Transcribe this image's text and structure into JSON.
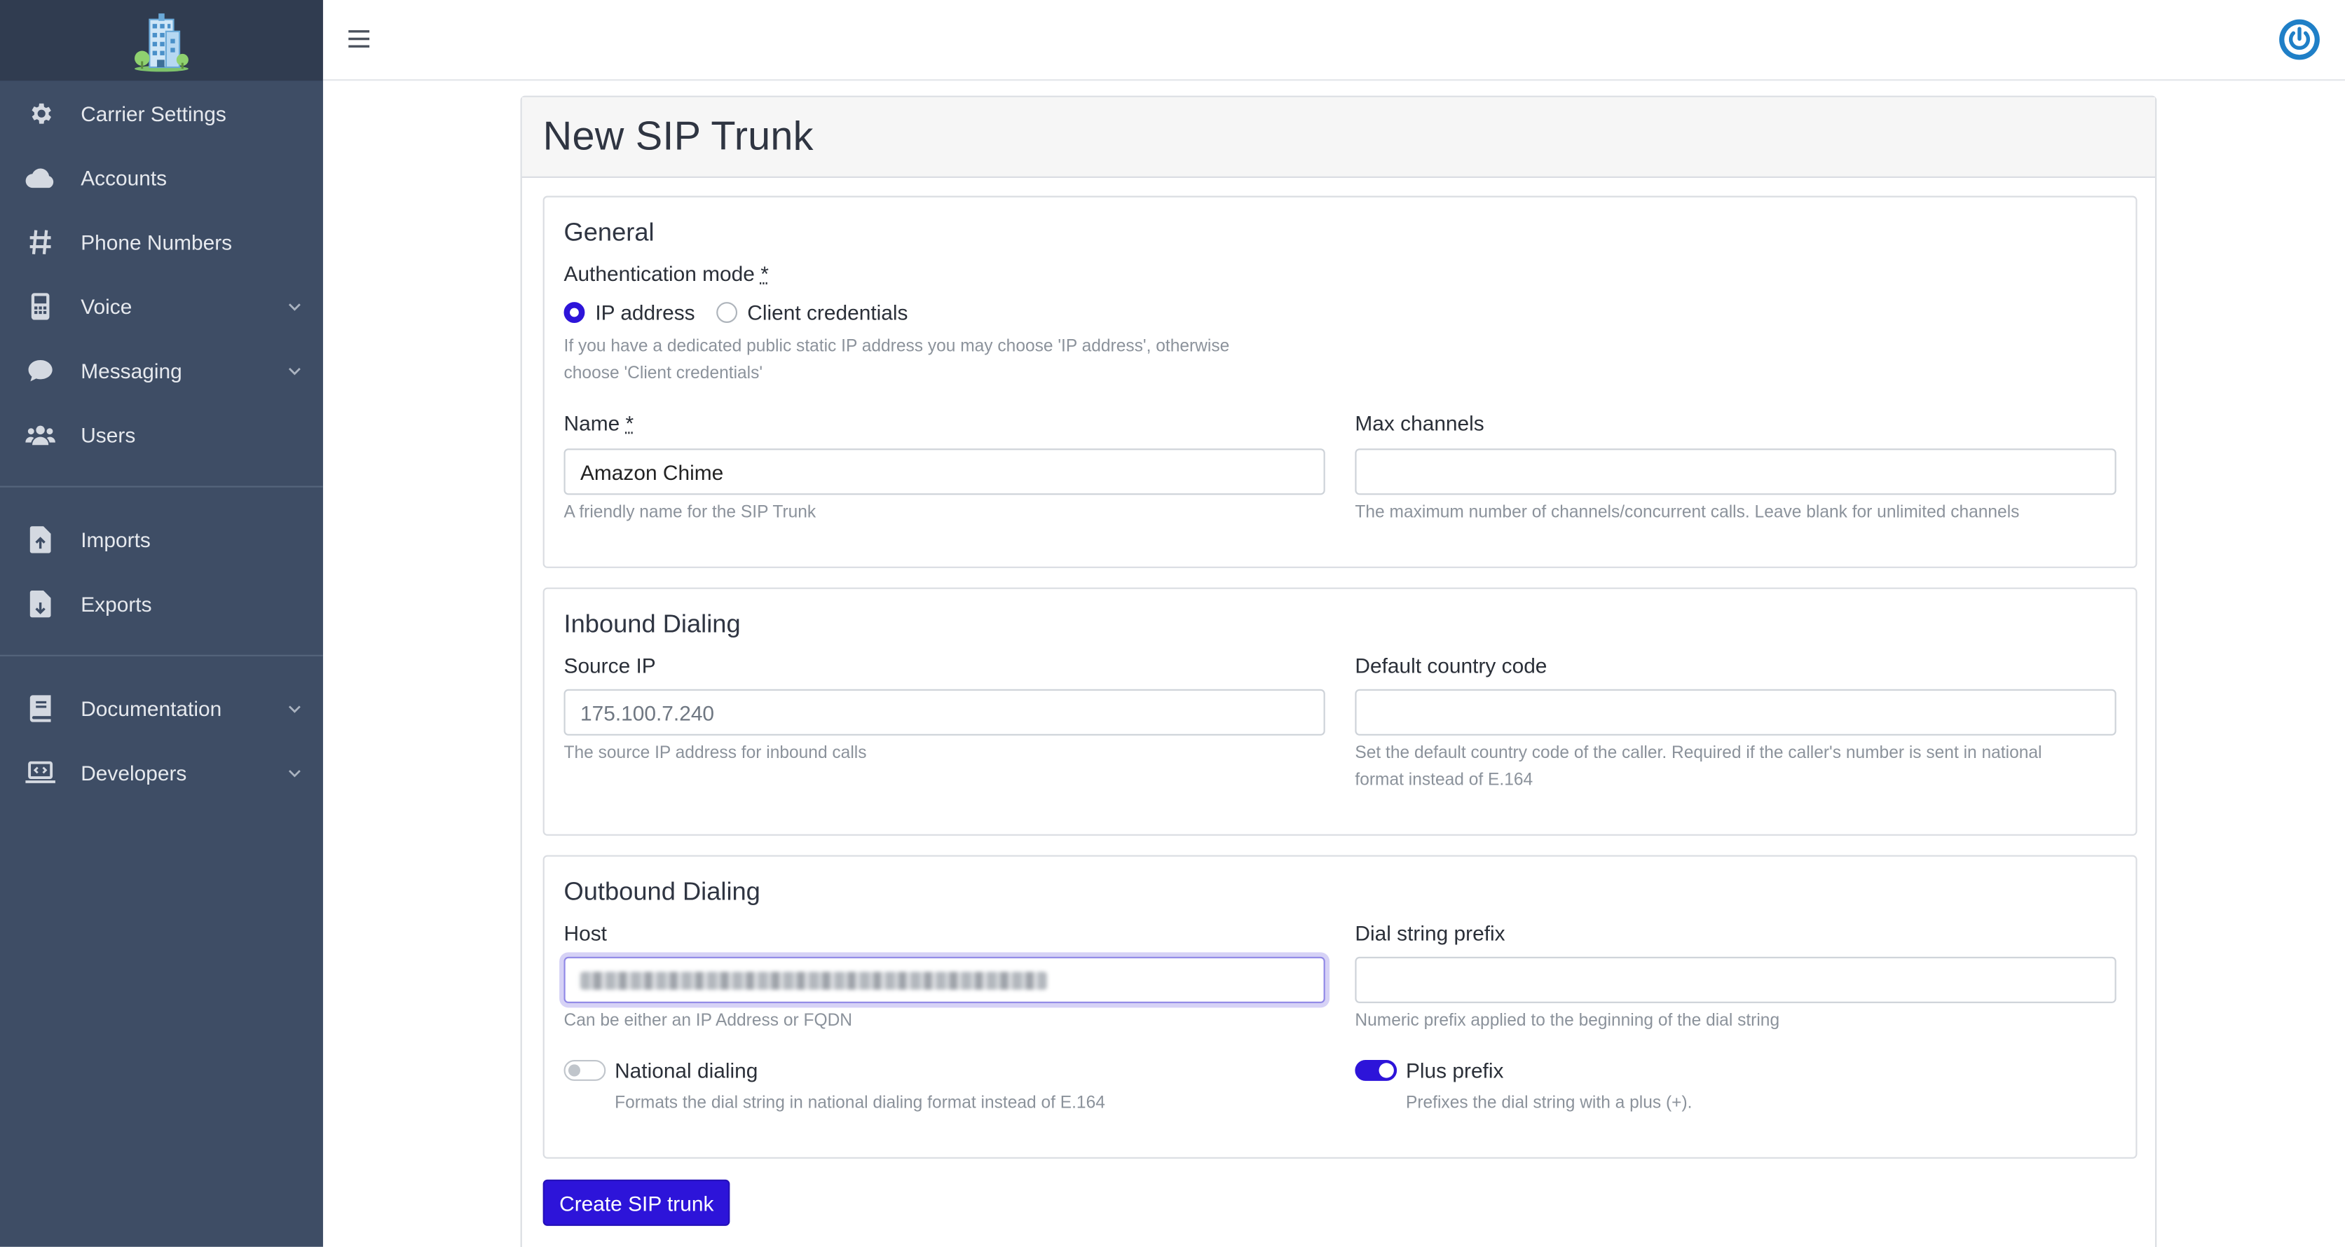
{
  "sidebar": {
    "logo_icon": "building-logo-icon",
    "items": [
      {
        "label": "Carrier Settings",
        "icon": "gear-icon"
      },
      {
        "label": "Accounts",
        "icon": "cloud-icon"
      },
      {
        "label": "Phone Numbers",
        "icon": "hash-icon"
      },
      {
        "label": "Voice",
        "icon": "phone-device-icon",
        "expandable": true
      },
      {
        "label": "Messaging",
        "icon": "chat-bubble-icon",
        "expandable": true
      },
      {
        "label": "Users",
        "icon": "users-icon"
      },
      {
        "label": "Imports",
        "icon": "file-import-icon"
      },
      {
        "label": "Exports",
        "icon": "file-export-icon"
      },
      {
        "label": "Documentation",
        "icon": "book-icon",
        "expandable": true
      },
      {
        "label": "Developers",
        "icon": "code-laptop-icon",
        "expandable": true
      }
    ]
  },
  "topbar": {
    "menu_icon": "hamburger-icon",
    "power_icon": "power-icon"
  },
  "page": {
    "title": "New SIP Trunk"
  },
  "general": {
    "heading": "General",
    "auth_label": "Authentication mode",
    "required_mark": "*",
    "auth_options": [
      {
        "label": "IP address",
        "selected": true
      },
      {
        "label": "Client credentials",
        "selected": false
      }
    ],
    "auth_help_line1": "If you have a dedicated public static IP address you may choose 'IP address', otherwise",
    "auth_help_line2": "choose 'Client credentials'",
    "name_label": "Name",
    "name_value": "Amazon Chime",
    "name_help": "A friendly name for the SIP Trunk",
    "max_channels_label": "Max channels",
    "max_channels_value": "",
    "max_channels_help": "The maximum number of channels/concurrent calls. Leave blank for unlimited channels"
  },
  "inbound": {
    "heading": "Inbound Dialing",
    "source_ip_label": "Source IP",
    "source_ip_placeholder": "175.100.7.240",
    "source_ip_help": "The source IP address for inbound calls",
    "country_code_label": "Default country code",
    "country_code_value": "",
    "country_code_help_line1": "Set the default country code of the caller. Required if the caller's number is sent in national",
    "country_code_help_line2": "format instead of E.164"
  },
  "outbound": {
    "heading": "Outbound Dialing",
    "host_label": "Host",
    "host_help": "Can be either an IP Address or FQDN",
    "prefix_label": "Dial string prefix",
    "prefix_value": "",
    "prefix_help": "Numeric prefix applied to the beginning of the dial string",
    "national_label": "National dialing",
    "national_on": false,
    "national_help": "Formats the dial string in national dialing format instead of E.164",
    "plus_label": "Plus prefix",
    "plus_on": true,
    "plus_help": "Prefixes the dial string with a plus (+)."
  },
  "actions": {
    "submit_label": "Create SIP trunk"
  },
  "colors": {
    "sidebar_bg": "#3e4d65",
    "brand_bg": "#303c50",
    "accent": "#2d14d9",
    "power": "#1f7fc7"
  }
}
